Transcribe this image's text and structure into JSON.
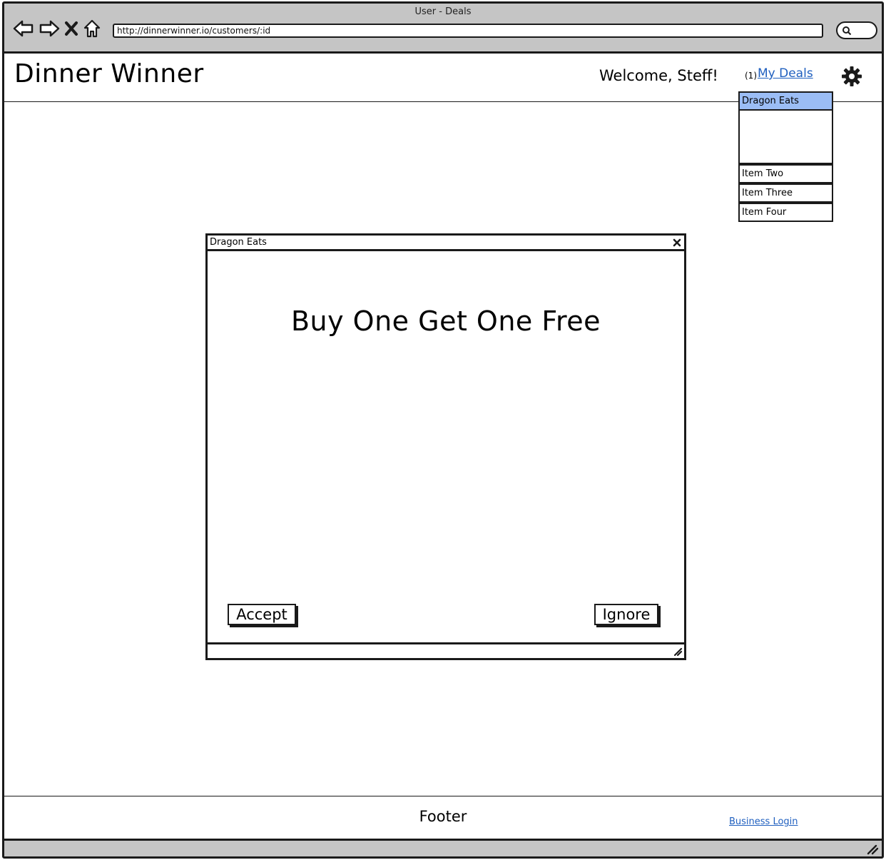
{
  "window": {
    "title": "User - Deals",
    "url": "http://dinnerwinner.io/customers/:id"
  },
  "header": {
    "brand": "Dinner Winner",
    "welcome": "Welcome, Steff!",
    "deals_count": "(1)",
    "deals_link": "My Deals"
  },
  "dropdown": {
    "selected": "Dragon Eats",
    "items": [
      "Item Two",
      "Item Three",
      "Item Four"
    ]
  },
  "dialog": {
    "title": "Dragon Eats",
    "heading": "Buy One Get One Free",
    "accept_label": "Accept",
    "ignore_label": "Ignore"
  },
  "footer": {
    "label": "Footer",
    "business_login": "Business Login"
  },
  "colors": {
    "link": "#1f5fbf",
    "selected_item": "#9bbdf5",
    "chrome": "#c5c5c5"
  },
  "icons": [
    "back-arrow-icon",
    "forward-arrow-icon",
    "close-x-icon",
    "home-icon",
    "search-icon",
    "gear-icon",
    "resize-grip-icon"
  ]
}
